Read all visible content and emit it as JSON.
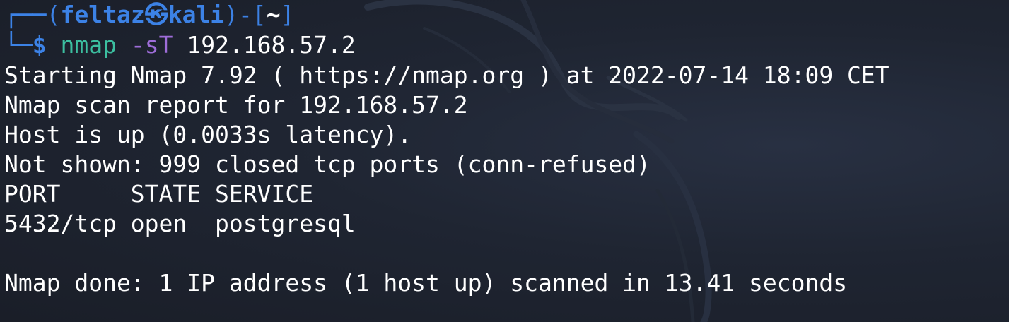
{
  "prompt": {
    "open_bracket": "┌──(",
    "user": "feltaz",
    "host_separator": "㉿",
    "host": "kali",
    "close_bracket": ")-[",
    "directory": "~",
    "close_dir": "]",
    "corner": "└─",
    "dollar": "$",
    "command": "nmap",
    "flag": "-sT",
    "argument": "192.168.57.2"
  },
  "output": {
    "lines": [
      "Starting Nmap 7.92 ( https://nmap.org ) at 2022-07-14 18:09 CET",
      "Nmap scan report for 192.168.57.2",
      "Host is up (0.0033s latency).",
      "Not shown: 999 closed tcp ports (conn-refused)",
      "PORT     STATE SERVICE",
      "5432/tcp open  postgresql",
      "",
      "Nmap done: 1 IP address (1 host up) scanned in 13.41 seconds"
    ]
  },
  "colors": {
    "background": "#1b1f2b",
    "prompt_blue": "#3c82e6",
    "command_green": "#3cbfa0",
    "flag_purple": "#9e6dd9",
    "text": "#ffffff"
  }
}
